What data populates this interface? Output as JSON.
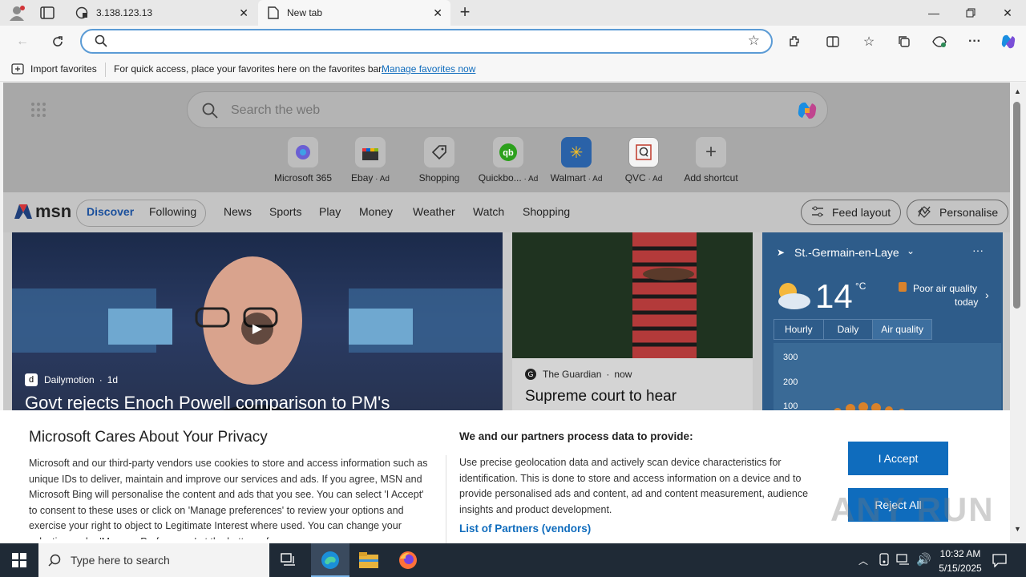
{
  "tabs": [
    {
      "title": "3.138.123.13",
      "icon": "globe-lock-icon"
    },
    {
      "title": "New tab",
      "icon": "page-icon"
    }
  ],
  "address": {
    "placeholder": ""
  },
  "favorites_bar": {
    "import_label": "Import favorites",
    "message": "For quick access, place your favorites here on the favorites bar.",
    "manage_link": "Manage favorites now"
  },
  "search": {
    "placeholder": "Search the web"
  },
  "shortcuts": [
    {
      "label": "Microsoft 365",
      "ad": ""
    },
    {
      "label": "Ebay",
      "ad": " · Ad"
    },
    {
      "label": "Shopping",
      "ad": ""
    },
    {
      "label": "Quickbo...",
      "ad": " · Ad"
    },
    {
      "label": "Walmart",
      "ad": " · Ad"
    },
    {
      "label": "QVC",
      "ad": " · Ad"
    },
    {
      "label": "Add shortcut",
      "ad": ""
    }
  ],
  "msn": {
    "logo": "msn",
    "tabs": [
      "Discover",
      "Following"
    ],
    "nav": [
      "News",
      "Sports",
      "Play",
      "Money",
      "Weather",
      "Watch",
      "Shopping"
    ],
    "feed_layout": "Feed layout",
    "personalise": "Personalise"
  },
  "cards": {
    "main": {
      "source": "Dailymotion",
      "age": "1d",
      "headline": "Govt rejects Enoch Powell comparison to PM's"
    },
    "second": {
      "source": "The Guardian",
      "age": "now",
      "headline": "Supreme court to hear"
    }
  },
  "weather": {
    "location": "St.-Germain-en-Laye",
    "temp": "14",
    "unit": "°C",
    "air_quality_line1": "Poor air quality",
    "air_quality_line2": "today",
    "tabs": [
      "Hourly",
      "Daily",
      "Air quality"
    ],
    "axis_values": [
      "300",
      "200",
      "100"
    ]
  },
  "privacy": {
    "title": "Microsoft Cares About Your Privacy",
    "body": "Microsoft and our third-party vendors use cookies to store and access information such as unique IDs to deliver, maintain and improve our services and ads. If you agree, MSN and Microsoft Bing will personalise the content and ads that you see. You can select 'I Accept' to consent to these uses or click on 'Manage preferences' to review your options and exercise your right to object to Legitimate Interest where used. You can change your selection under 'Manage Preferences' at the bottom of",
    "partners_title": "We and our partners process data to provide:",
    "partners_body": "Use precise geolocation data and actively scan device characteristics for identification. This is done to store and access information on a device and to provide personalised ads and content, ad and content measurement, audience insights and product development.",
    "partners_link": "List of Partners (vendors)",
    "accept": "I Accept",
    "reject": "Reject All"
  },
  "watermark": "ANY RUN",
  "taskbar": {
    "search_placeholder": "Type here to search",
    "time": "10:32 AM",
    "date": "5/15/2025"
  },
  "colors": {
    "accent": "#0f6cbd",
    "taskbar": "#1f2a36",
    "msn_blue": "#1a5fb4"
  }
}
